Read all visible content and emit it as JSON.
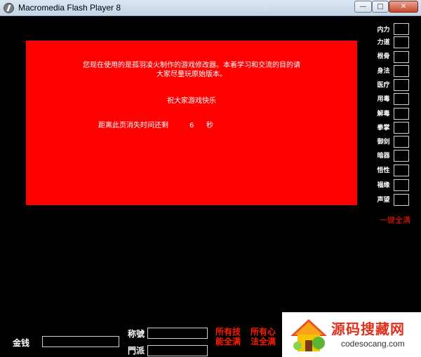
{
  "window": {
    "title": "Macromedia Flash Player 8",
    "min_glyph": "—",
    "max_glyph": "□",
    "close_glyph": "✕"
  },
  "notice": {
    "line1": "您现在使用的是孤羽凌火制作的游戏修改器。本着学习和交流的目的请",
    "line2": "大家尽量玩原始版本。",
    "line3": "祝大家游戏快乐",
    "countdown_label": "距离此页消失时间还剩",
    "countdown_value": "6",
    "countdown_unit": "秒"
  },
  "stats": {
    "items": [
      {
        "label": "内力"
      },
      {
        "label": "力道"
      },
      {
        "label": "根骨"
      },
      {
        "label": "身法"
      },
      {
        "label": "医疗"
      },
      {
        "label": "用毒"
      },
      {
        "label": "解毒"
      },
      {
        "label": "拳掌"
      },
      {
        "label": "御剑"
      },
      {
        "label": "暗器"
      },
      {
        "label": "悟性"
      },
      {
        "label": "福缘"
      },
      {
        "label": "声望"
      }
    ],
    "fill_all": "一键全满"
  },
  "bottom": {
    "money_label": "金钱",
    "title_label": "称號",
    "sect_label": "門派",
    "btn_all_skills": "所有技",
    "btn_can_max": "能全满",
    "btn_all_heart": "所有心",
    "btn_method_max": "法全满"
  },
  "watermark": {
    "name_cn": "源码搜藏网",
    "name_en": "codesocang.com"
  },
  "colors": {
    "panel_red": "#fe0000",
    "accent_red": "#ff1a00",
    "background": "#000000"
  }
}
